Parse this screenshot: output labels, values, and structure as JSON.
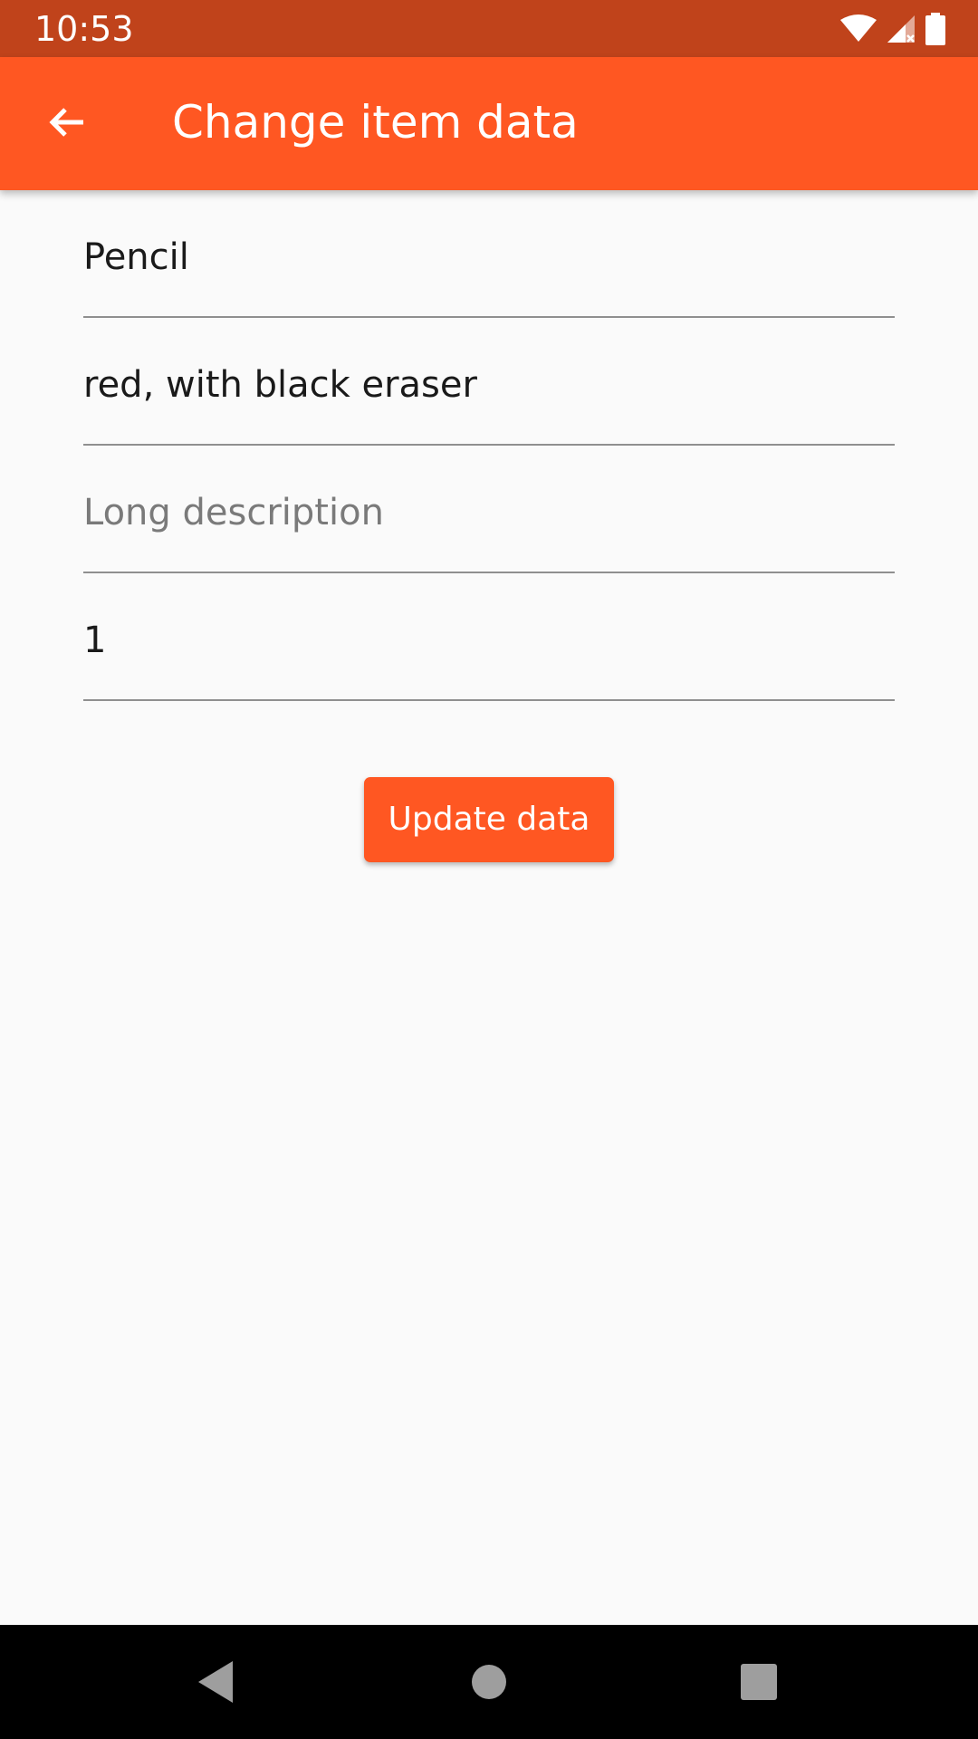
{
  "status_bar": {
    "time": "10:53",
    "icons": [
      "wifi-icon",
      "signal-icon",
      "battery-icon"
    ],
    "background": "#c0431b"
  },
  "app_bar": {
    "title": "Change item data",
    "back_icon": "arrow-back-icon",
    "background": "#ff5722"
  },
  "form": {
    "name_value": "Pencil",
    "short_description_value": "red, with black eraser",
    "long_description_placeholder": "Long description",
    "quantity_value": "1"
  },
  "actions": {
    "update_label": "Update data",
    "accent": "#ff5722"
  },
  "nav_bar": {
    "icons": [
      "back-triangle-icon",
      "home-circle-icon",
      "recents-square-icon"
    ]
  }
}
